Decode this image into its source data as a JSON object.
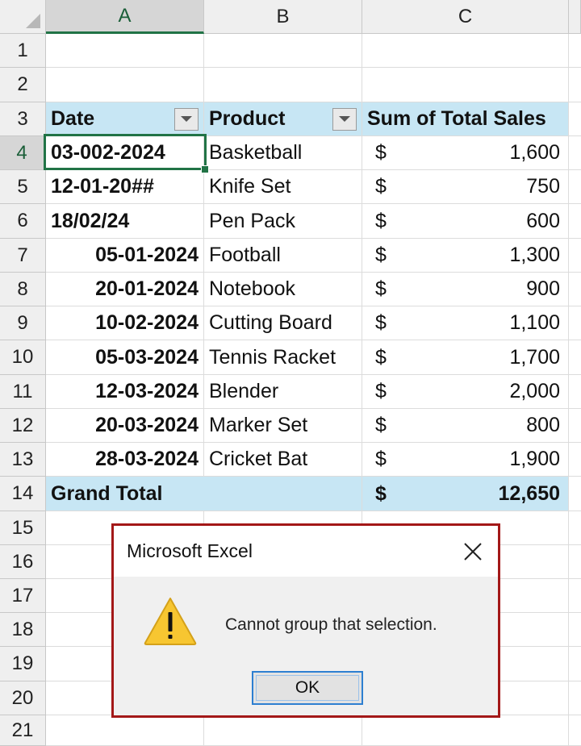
{
  "columns": [
    "A",
    "B",
    "C"
  ],
  "rows": [
    "1",
    "2",
    "3",
    "4",
    "5",
    "6",
    "7",
    "8",
    "9",
    "10",
    "11",
    "12",
    "13",
    "14",
    "15",
    "16",
    "17",
    "18",
    "19",
    "20",
    "21"
  ],
  "pivot": {
    "headers": {
      "date": "Date",
      "product": "Product",
      "sales": "Sum of Total Sales"
    },
    "records": [
      {
        "date": "03-002-2024",
        "product": "Basketball",
        "currency": "$",
        "amount": "1,600"
      },
      {
        "date": "12-01-20##",
        "product": "Knife Set",
        "currency": "$",
        "amount": "750"
      },
      {
        "date": "18/02/24",
        "product": "Pen Pack",
        "currency": "$",
        "amount": "600"
      },
      {
        "date": "05-01-2024",
        "product": "Football",
        "currency": "$",
        "amount": "1,300"
      },
      {
        "date": "20-01-2024",
        "product": "Notebook",
        "currency": "$",
        "amount": "900"
      },
      {
        "date": "10-02-2024",
        "product": "Cutting Board",
        "currency": "$",
        "amount": "1,100"
      },
      {
        "date": "05-03-2024",
        "product": "Tennis Racket",
        "currency": "$",
        "amount": "1,700"
      },
      {
        "date": "12-03-2024",
        "product": "Blender",
        "currency": "$",
        "amount": "2,000"
      },
      {
        "date": "20-03-2024",
        "product": "Marker Set",
        "currency": "$",
        "amount": "800"
      },
      {
        "date": "28-03-2024",
        "product": "Cricket Bat",
        "currency": "$",
        "amount": "1,900"
      }
    ],
    "grand_total": {
      "label": "Grand Total",
      "currency": "$",
      "amount": "12,650"
    }
  },
  "active_cell": "A4",
  "dialog": {
    "title": "Microsoft Excel",
    "message": "Cannot group that selection.",
    "ok_label": "OK",
    "icon": "warning-icon"
  },
  "colors": {
    "pivot_header_bg": "#c7e6f4",
    "selection": "#217346",
    "dialog_border": "#a31818",
    "warning": "#f7c631"
  }
}
